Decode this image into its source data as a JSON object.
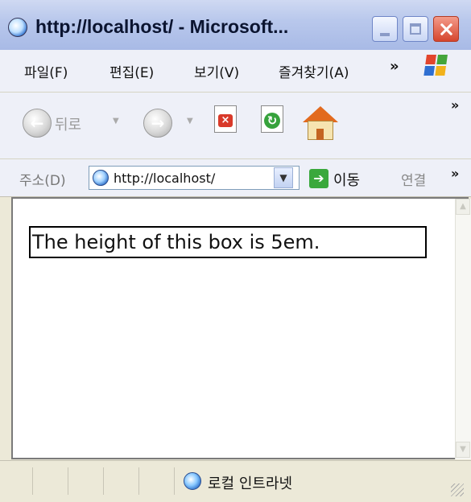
{
  "window": {
    "title": "http://localhost/ - Microsoft...",
    "controls": {
      "minimize": "minimize",
      "maximize": "maximize",
      "close": "close"
    }
  },
  "menu": {
    "items": [
      "파일(F)",
      "편집(E)",
      "보기(V)",
      "즐겨찾기(A)"
    ],
    "overflow": "»"
  },
  "toolbar": {
    "back_label": "뒤로",
    "overflow": "»",
    "icons": [
      "back-arrow-icon",
      "forward-arrow-icon",
      "stop-icon",
      "refresh-icon",
      "home-icon"
    ]
  },
  "address": {
    "label": "주소(D)",
    "url": "http://localhost/",
    "go_label": "이동",
    "links_label": "연결",
    "overflow": "»"
  },
  "page": {
    "box_text": "The height of this box is 5em."
  },
  "status": {
    "zone_text": "로컬 인트라넷"
  },
  "colors": {
    "titlebar": "#b9c8ec",
    "close": "#d6452d",
    "chrome": "#eef0f8",
    "statusbar": "#ece9d8"
  }
}
